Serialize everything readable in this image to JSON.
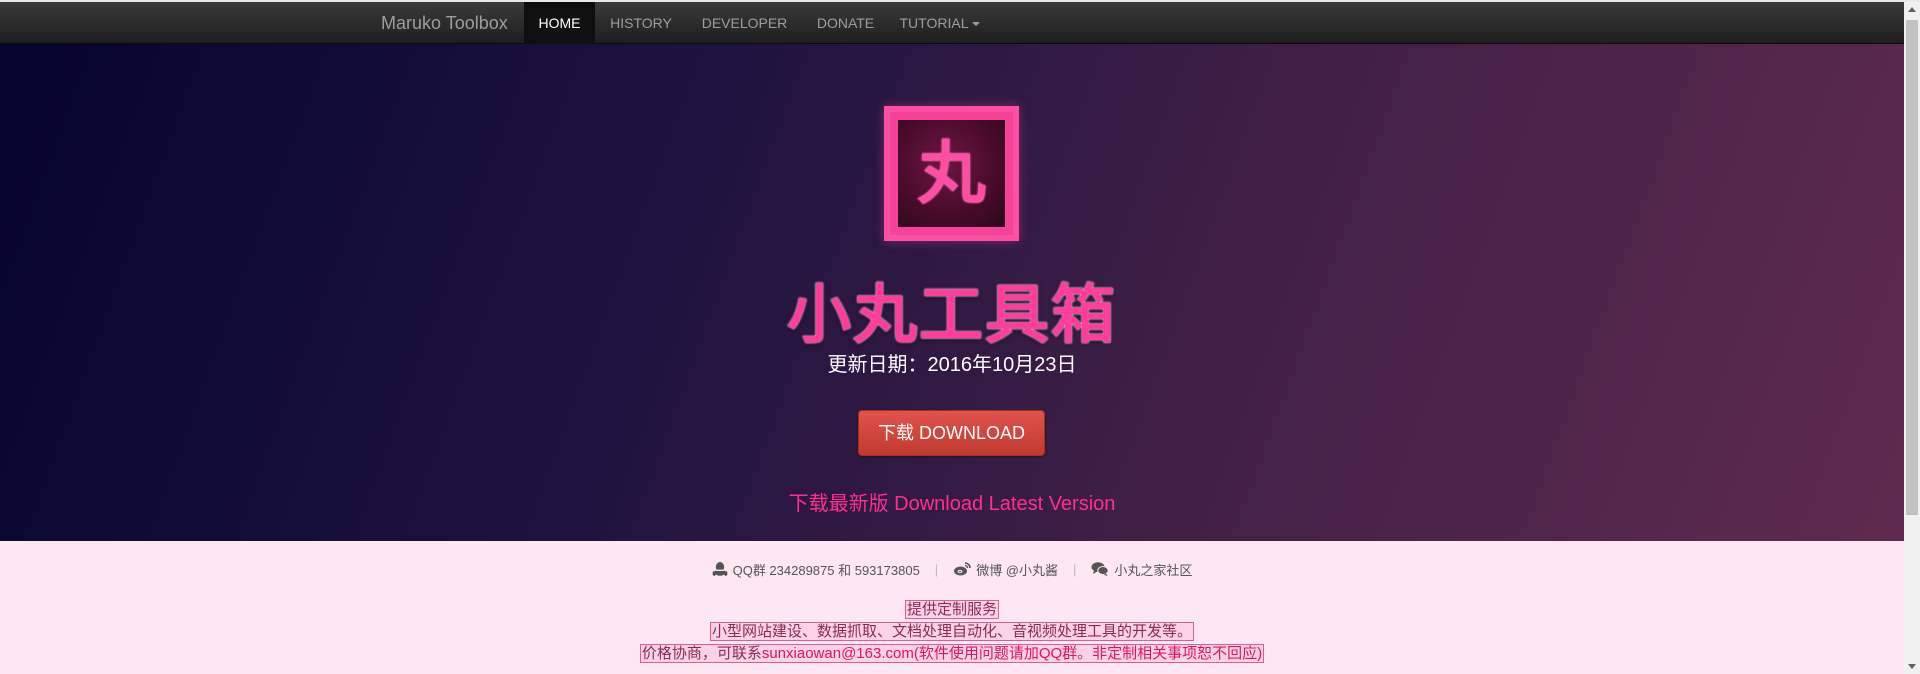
{
  "navbar": {
    "brand": "Maruko Toolbox",
    "items": [
      {
        "label": "HOME",
        "active": true
      },
      {
        "label": "HISTORY",
        "active": false
      },
      {
        "label": "DEVELOPER",
        "active": false
      },
      {
        "label": "DONATE",
        "active": false
      },
      {
        "label": "TUTORIAL",
        "active": false,
        "dropdown": true
      }
    ]
  },
  "hero": {
    "logo_glyph": "丸",
    "title": "小丸工具箱",
    "update_date": "更新日期：2016年10月23日",
    "download_button": "下载 DOWNLOAD",
    "latest_link": "下载最新版 Download Latest Version"
  },
  "footer": {
    "qq": "QQ群 234289875 和 593173805",
    "weibo": "微博 @小丸酱",
    "community": "小丸之家社区",
    "service_title": "提供定制服务",
    "service_desc": "小型网站建设、数据抓取、文档处理自动化、音视频处理工具的开发等。",
    "price_prefix": "价格协商，可联系",
    "email": "sunxiaowan@163.com",
    "price_suffix": "(软件使用问题请加QQ群。非定制相关事项恕不回应)"
  },
  "colors": {
    "accent_pink": "#ff3d9a",
    "download_red": "#d4473d",
    "navbar_bg": "#222222",
    "footer_bg": "#fde7f1"
  },
  "icons": {
    "qq": "qq-penguin-icon",
    "weibo": "weibo-icon",
    "community": "chat-bubbles-icon",
    "dropdown": "caret-down-icon"
  }
}
